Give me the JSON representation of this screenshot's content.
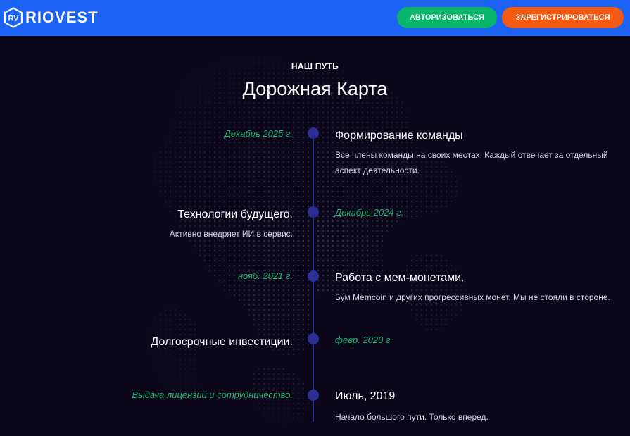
{
  "header": {
    "logo_mark": "RV",
    "logo_text": "RIOVEST",
    "login_label": "АВТОРИЗОВАТЬСЯ",
    "register_label": "ЗАРЕГИСТРИРОВАТЬСЯ",
    "colors": {
      "bar": "#1c63f5",
      "login": "#09b46b",
      "register": "#f45a11"
    }
  },
  "section": {
    "eyebrow": "НАШ ПУТЬ",
    "title": "Дорожная Карта"
  },
  "timeline": [
    {
      "date": "Декабрь 2025 г.",
      "title": "Формирование команды",
      "text": "Все члены команды на своих местах. Каждый отвечает за отдельный аспект деятельности."
    },
    {
      "date": "Декабрь 2024 г.",
      "title": "Технологии будущего.",
      "text": "Активно внедряет ИИ в сервис."
    },
    {
      "date": "нояб. 2021 г.",
      "title": "Работа с мем-монетами.",
      "text": "Бум Memcoin и других прогрессивных монет. Мы не стояли в стороне."
    },
    {
      "date": "февр. 2020 г.",
      "title": "Долгосрочные инвестиции.",
      "text": ""
    },
    {
      "date": "Выдача лицензий и сотрудничество.",
      "title": "Июль, 2019",
      "text": "Начало большого пути. Только вперед."
    }
  ],
  "colors": {
    "background": "#0b0719",
    "accent_date": "#1fb46e",
    "timeline": "#2c2f93"
  }
}
